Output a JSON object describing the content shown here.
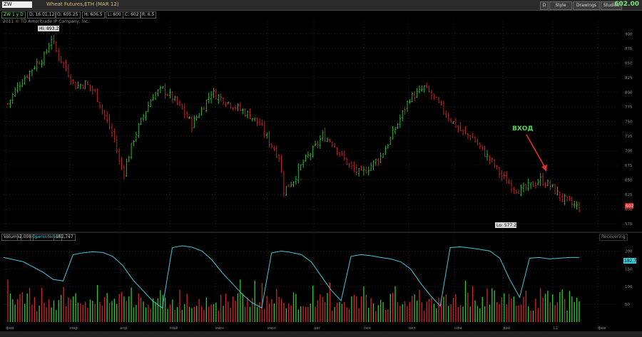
{
  "toolbar": {
    "symbol": "ZW",
    "description": "Wheat Futures,ETH (MAR 12)",
    "buttons": [
      "Style",
      "Drawings",
      "Studies"
    ],
    "period": "D",
    "last_price": "602.00"
  },
  "info": {
    "chart": "ZW 1 y D",
    "date": "D: 16.01.12",
    "open": "O: 605.25",
    "high": "H: 606.5",
    "low": "L: 600",
    "close": "C: 602",
    "range": "R: 6.5"
  },
  "copyright": "2011 © TD Ameritrade IP Company, Inc.",
  "annotations": {
    "high": "Hi: 893.25",
    "low": "Lo: 577.25",
    "entry": "ВХОД",
    "price_tag": "602",
    "oi_tag": "182.75"
  },
  "volume_panel": {
    "volume": "Volume",
    "volume_value": "2,008",
    "oi": "OpenInterest",
    "oi_value": "182,747",
    "right_label": "Recovering"
  },
  "colors": {
    "up": "#2fc62f",
    "down": "#d02626",
    "oi_line": "#42c8d8",
    "entry": "#4adf4a",
    "arrow": "#e03030"
  },
  "chart_data": {
    "type": "ohlc",
    "price_axis": {
      "ticks": [
        "900",
        "875",
        "850",
        "825",
        "800",
        "775",
        "750",
        "725",
        "700",
        "675",
        "650",
        "625",
        "600",
        "575"
      ],
      "range": [
        570,
        915
      ]
    },
    "volume_axis": {
      "ticks": [
        "200",
        "150",
        "100",
        "50"
      ],
      "range": [
        0,
        225
      ]
    },
    "months": [
      "фев",
      "мар",
      "апр",
      "май",
      "июн",
      "июл",
      "авг",
      "сен",
      "окт",
      "ноя",
      "дек",
      "12",
      "фев"
    ],
    "close_path": [
      [
        0,
        780
      ],
      [
        4,
        810
      ],
      [
        8,
        830
      ],
      [
        12,
        850
      ],
      [
        15,
        860
      ],
      [
        18,
        893
      ],
      [
        20,
        870
      ],
      [
        24,
        840
      ],
      [
        28,
        810
      ],
      [
        32,
        815
      ],
      [
        36,
        800
      ],
      [
        40,
        760
      ],
      [
        44,
        720
      ],
      [
        46,
        680
      ],
      [
        48,
        665
      ],
      [
        52,
        720
      ],
      [
        56,
        760
      ],
      [
        60,
        795
      ],
      [
        64,
        805
      ],
      [
        68,
        790
      ],
      [
        72,
        770
      ],
      [
        76,
        745
      ],
      [
        80,
        770
      ],
      [
        84,
        800
      ],
      [
        88,
        790
      ],
      [
        92,
        780
      ],
      [
        96,
        770
      ],
      [
        100,
        760
      ],
      [
        104,
        745
      ],
      [
        108,
        715
      ],
      [
        112,
        690
      ],
      [
        114,
        632
      ],
      [
        118,
        650
      ],
      [
        122,
        680
      ],
      [
        126,
        700
      ],
      [
        130,
        725
      ],
      [
        134,
        715
      ],
      [
        138,
        690
      ],
      [
        142,
        670
      ],
      [
        146,
        660
      ],
      [
        150,
        675
      ],
      [
        154,
        690
      ],
      [
        158,
        720
      ],
      [
        162,
        755
      ],
      [
        166,
        790
      ],
      [
        170,
        800
      ],
      [
        172,
        808
      ],
      [
        176,
        790
      ],
      [
        180,
        768
      ],
      [
        184,
        748
      ],
      [
        188,
        730
      ],
      [
        192,
        722
      ],
      [
        196,
        700
      ],
      [
        200,
        680
      ],
      [
        204,
        656
      ],
      [
        208,
        640
      ],
      [
        212,
        631
      ],
      [
        216,
        640
      ],
      [
        220,
        650
      ],
      [
        224,
        640
      ],
      [
        228,
        622
      ],
      [
        232,
        610
      ],
      [
        236,
        602
      ]
    ],
    "volume": [
      95,
      60,
      70,
      55,
      65,
      60,
      85,
      70,
      75,
      90,
      60,
      55,
      50,
      65,
      70,
      80,
      60,
      75,
      55,
      60,
      45,
      58,
      66,
      72,
      40,
      50,
      48,
      62,
      70,
      55,
      80,
      65,
      44,
      58,
      52,
      60,
      73,
      85,
      50,
      47,
      66,
      70,
      55,
      61,
      48,
      52,
      64,
      70,
      58,
      45,
      75,
      80,
      62,
      55,
      68,
      59,
      47,
      66,
      71,
      54,
      48,
      52,
      60,
      67,
      73,
      58,
      49,
      61,
      55,
      50,
      65,
      70,
      56,
      60,
      74,
      52,
      46,
      57,
      63,
      69,
      72,
      55,
      50,
      48,
      62,
      60,
      51,
      47,
      66,
      70,
      58,
      55,
      62,
      100,
      80,
      60
    ],
    "open_interest": [
      182,
      176,
      170,
      155,
      140,
      120,
      116,
      190,
      195,
      198,
      196,
      185,
      160,
      120,
      90,
      60,
      40,
      210,
      215,
      211,
      200,
      175,
      140,
      110,
      80,
      55,
      40,
      195,
      200,
      196,
      190,
      170,
      130,
      90,
      60,
      185,
      190,
      187,
      182,
      178,
      170,
      150,
      110,
      75,
      45,
      210,
      212,
      209,
      205,
      200,
      180,
      120,
      70,
      180,
      182,
      178,
      180,
      182,
      182
    ]
  }
}
